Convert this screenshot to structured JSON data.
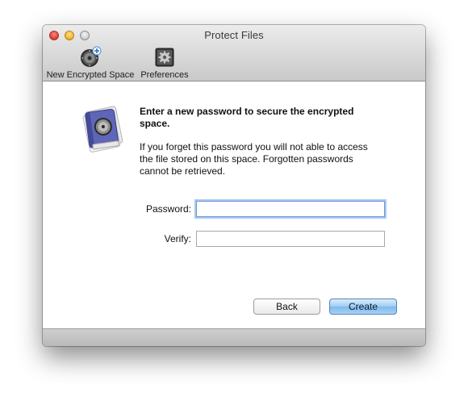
{
  "window": {
    "title": "Protect Files"
  },
  "toolbar": {
    "new_space_label": "New Encrypted Space",
    "new_space_icon": "safe-dial-add-icon",
    "preferences_label": "Preferences",
    "preferences_icon": "gear-icon"
  },
  "content": {
    "app_icon": "encrypted-book-icon",
    "heading": "Enter a new password to secure the encrypted space.",
    "description": "If you forget this password you will not able to access the file stored on this space. Forgotten passwords cannot be retrieved."
  },
  "form": {
    "password_label": "Password:",
    "password_value": "",
    "verify_label": "Verify:",
    "verify_value": ""
  },
  "buttons": {
    "back_label": "Back",
    "create_label": "Create"
  },
  "colors": {
    "accent": "#7fb9ec",
    "focus_ring": "#a9c8f2"
  }
}
